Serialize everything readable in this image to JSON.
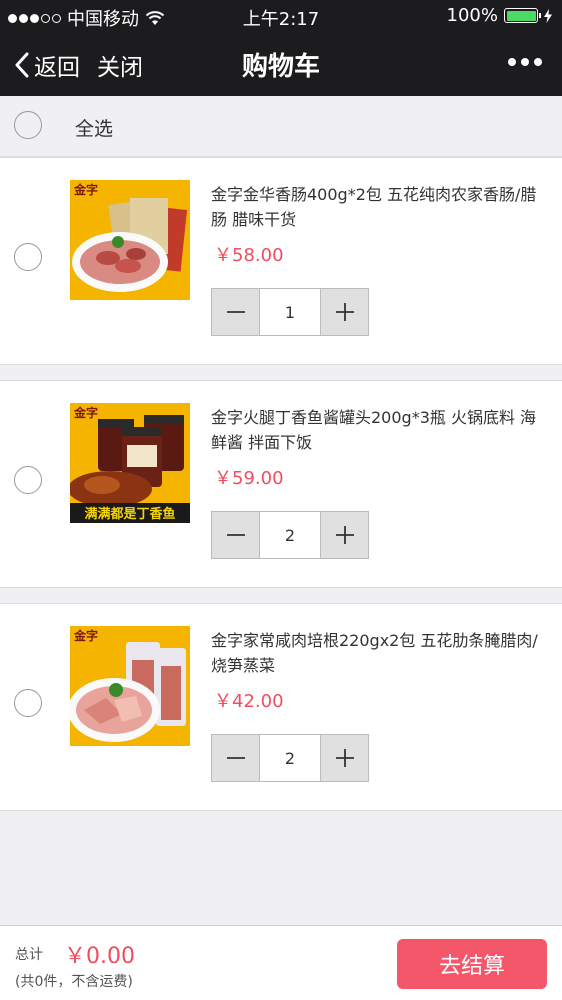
{
  "status_bar": {
    "carrier": "中国移动",
    "time": "上午2:17",
    "battery": "100%"
  },
  "nav": {
    "back_label": "返回",
    "close_label": "关闭",
    "title": "购物车"
  },
  "select_all": {
    "label": "全选",
    "checked": false
  },
  "items": [
    {
      "title": "金字金华香肠400g*2包 五花纯肉农家香肠/腊肠 腊味干货",
      "price": "￥58.00",
      "quantity": "1",
      "checked": false
    },
    {
      "title": "金字火腿丁香鱼酱罐头200g*3瓶 火锅底料 海鲜酱 拌面下饭",
      "price": "￥59.00",
      "quantity": "2",
      "checked": false,
      "image_caption": "满满都是丁香鱼"
    },
    {
      "title": "金字家常咸肉培根220gx2包 五花肋条腌腊肉/烧笋蒸菜",
      "price": "￥42.00",
      "quantity": "2",
      "checked": false
    }
  ],
  "image_logo_text": "金字",
  "footer": {
    "total_label": "总计",
    "total_value": "￥0.00",
    "total_note": "(共0件，不含运费)",
    "checkout_label": "去结算"
  },
  "colors": {
    "accent": "#f5576a",
    "price": "#f04e5e",
    "nav_bg": "#1c1c1e",
    "battery": "#4cd964"
  }
}
